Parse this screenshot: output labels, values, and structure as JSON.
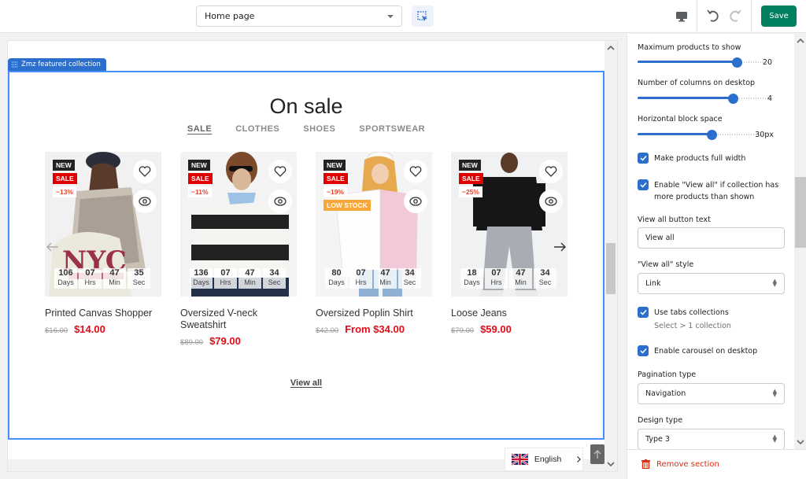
{
  "topbar": {
    "page_select": "Home page",
    "save_label": "Save"
  },
  "section": {
    "tab_label": "Zmz featured collection",
    "heading": "On sale",
    "tabs": [
      {
        "label": "SALE",
        "active": true
      },
      {
        "label": "CLOTHES",
        "active": false
      },
      {
        "label": "SHOES",
        "active": false
      },
      {
        "label": "SPORTSWEAR",
        "active": false
      }
    ],
    "view_all": "View all",
    "products": [
      {
        "title": "Printed Canvas Shopper",
        "old_price": "$16.00",
        "price": "$14.00",
        "badges": [
          "NEW",
          "SALE",
          "−13%"
        ],
        "countdown": {
          "days": "106",
          "hrs": "07",
          "min": "47",
          "sec": "35"
        }
      },
      {
        "title": "Oversized V-neck Sweatshirt",
        "old_price": "$89.00",
        "price": "$79.00",
        "badges": [
          "NEW",
          "SALE",
          "−11%"
        ],
        "countdown": {
          "days": "136",
          "hrs": "07",
          "min": "47",
          "sec": "34"
        }
      },
      {
        "title": "Oversized Poplin Shirt",
        "old_price": "$42.00",
        "price": "From $34.00",
        "badges": [
          "NEW",
          "SALE",
          "−19%",
          "LOW STOCK"
        ],
        "countdown": {
          "days": "80",
          "hrs": "07",
          "min": "47",
          "sec": "34"
        }
      },
      {
        "title": "Loose Jeans",
        "old_price": "$79.00",
        "price": "$59.00",
        "badges": [
          "NEW",
          "SALE",
          "−25%"
        ],
        "countdown": {
          "days": "18",
          "hrs": "07",
          "min": "47",
          "sec": "34"
        }
      }
    ],
    "countdown_labels": {
      "days": "Days",
      "hrs": "Hrs",
      "min": "Min",
      "sec": "Sec"
    },
    "language": "English"
  },
  "settings": {
    "max_products": {
      "label": "Maximum products to show",
      "value": "20",
      "fraction": 0.75
    },
    "columns": {
      "label": "Number of columns on desktop",
      "value": "4",
      "fraction": 0.72
    },
    "block_space": {
      "label": "Horizontal block space",
      "value": "30px",
      "fraction": 0.56
    },
    "full_width": {
      "label": "Make products full width",
      "checked": true
    },
    "enable_view_all": {
      "label": "Enable \"View all\" if collection has more products than shown",
      "checked": true
    },
    "view_all_text": {
      "label": "View all button text",
      "value": "View all"
    },
    "view_all_style": {
      "label": "\"View all\" style",
      "value": "Link"
    },
    "use_tabs": {
      "label": "Use tabs collections",
      "help": "Select > 1 collection",
      "checked": true
    },
    "carousel": {
      "label": "Enable carousel on desktop",
      "checked": true
    },
    "pagination": {
      "label": "Pagination type",
      "value": "Navigation"
    },
    "design": {
      "label": "Design type",
      "value": "Type 3"
    },
    "remove_label": "Remove section"
  }
}
